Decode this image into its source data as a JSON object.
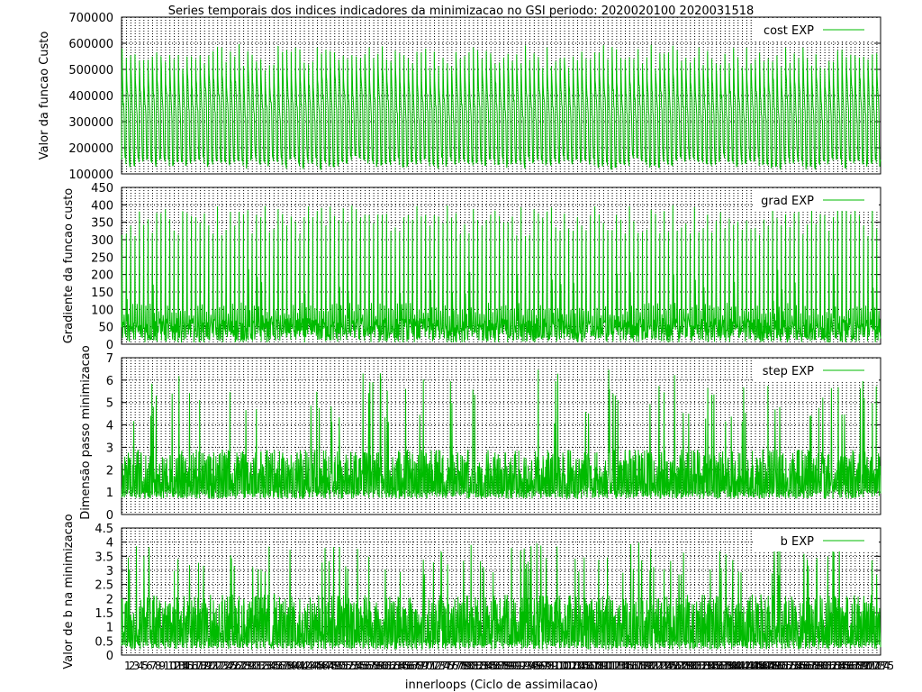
{
  "title": "Series temporais dos indices indicadores da minimizacao no GSI periodo: 2020020100 2020031518",
  "xlabel": "innerloops (Ciclo de assimilacao)",
  "x_tick_labels": [
    "1",
    "2",
    "3",
    "4",
    "5",
    "6",
    "7",
    "8",
    "9",
    "1011",
    "12",
    "13",
    "14",
    "15",
    "16",
    "17",
    "18",
    "19",
    "20",
    "21",
    "22",
    "23",
    "24",
    "25",
    "26",
    "27",
    "28",
    "29",
    "30",
    "31",
    "32",
    "33",
    "34",
    "35",
    "36",
    "37",
    "38",
    "39",
    "40",
    "41",
    "42",
    "43",
    "44",
    "45",
    "46",
    "47",
    "48",
    "49",
    "50",
    "51",
    "52",
    "53",
    "54",
    "55",
    "56",
    "57",
    "58",
    "59",
    "60",
    "61",
    "62",
    "63",
    "64",
    "65",
    "66",
    "67",
    "68",
    "69",
    "70",
    "71",
    "72",
    "73",
    "74",
    "75",
    "76",
    "77",
    "78",
    "79",
    "80",
    "81",
    "82",
    "83",
    "84",
    "85",
    "86",
    "87",
    "88",
    "89",
    "90",
    "91",
    "92",
    "93",
    "94",
    "95",
    "96",
    "97",
    "98",
    "99",
    "100",
    "101",
    "102",
    "103",
    "104",
    "105",
    "106",
    "107",
    "108",
    "109",
    "110",
    "111",
    "112",
    "113",
    "114",
    "115",
    "116",
    "117",
    "118",
    "119",
    "120",
    "121",
    "122",
    "123",
    "124",
    "125",
    "126",
    "127",
    "128",
    "129",
    "130",
    "131",
    "132",
    "133",
    "134",
    "135",
    "136",
    "137",
    "138",
    "139",
    "140",
    "141",
    "142",
    "143",
    "144",
    "145",
    "146",
    "147",
    "148",
    "149",
    "150",
    "151",
    "152",
    "153",
    "154",
    "155",
    "156",
    "157",
    "158",
    "159",
    "160",
    "161",
    "162",
    "163",
    "164",
    "165",
    "166",
    "167",
    "168",
    "169",
    "170",
    "171",
    "172",
    "173",
    "174",
    "175"
  ],
  "colors": {
    "series": "#00bb00",
    "grid": "#000000",
    "background": "#ffffff"
  },
  "chart_data": [
    {
      "type": "line",
      "ylabel": "Valor da funcao Custo",
      "ylim": [
        100000,
        700000
      ],
      "yticks": [
        "100000",
        "200000",
        "300000",
        "400000",
        "500000",
        "600000",
        "700000"
      ],
      "legend": "cost EXP",
      "legend_position": "top-right",
      "grid": true,
      "x_range": [
        1,
        175
      ],
      "series": [
        {
          "name": "cost EXP",
          "pattern": "per cycle ~600000 peak decaying to ~300000, then ~150000 minimum"
        }
      ]
    },
    {
      "type": "line",
      "ylabel": "Gradiente da funcao custo",
      "ylim": [
        0,
        450
      ],
      "yticks": [
        "0",
        "50",
        "100",
        "150",
        "200",
        "250",
        "300",
        "350",
        "400",
        "450"
      ],
      "legend": "grad EXP",
      "legend_position": "top-right",
      "grid": true,
      "x_range": [
        1,
        175
      ],
      "series": [
        {
          "name": "grad EXP",
          "pattern": "spikes ~330-400 per cycle, mostly below 100"
        }
      ]
    },
    {
      "type": "line",
      "ylabel": "Dimensão passo minimizacao",
      "ylim": [
        0,
        7
      ],
      "yticks": [
        "0",
        "1",
        "2",
        "3",
        "4",
        "5",
        "6",
        "7"
      ],
      "legend": "step EXP",
      "legend_position": "top-right",
      "grid": true,
      "x_range": [
        1,
        175
      ],
      "series": [
        {
          "name": "step EXP",
          "pattern": "dense band ~1 to ~3, occasional peaks up to ~6.8"
        }
      ]
    },
    {
      "type": "line",
      "ylabel": "Valor de b na minimizacao",
      "ylim": [
        0,
        4.5
      ],
      "yticks": [
        "0",
        "0.5",
        "1",
        "1.5",
        "2",
        "2.5",
        "3",
        "3.5",
        "4",
        "4.5"
      ],
      "legend": "b EXP",
      "legend_position": "top-right",
      "grid": true,
      "x_range": [
        1,
        175
      ],
      "series": [
        {
          "name": "b EXP",
          "pattern": "dense band ~0.3 to ~2.2, occasional peaks up to ~4"
        }
      ]
    }
  ]
}
